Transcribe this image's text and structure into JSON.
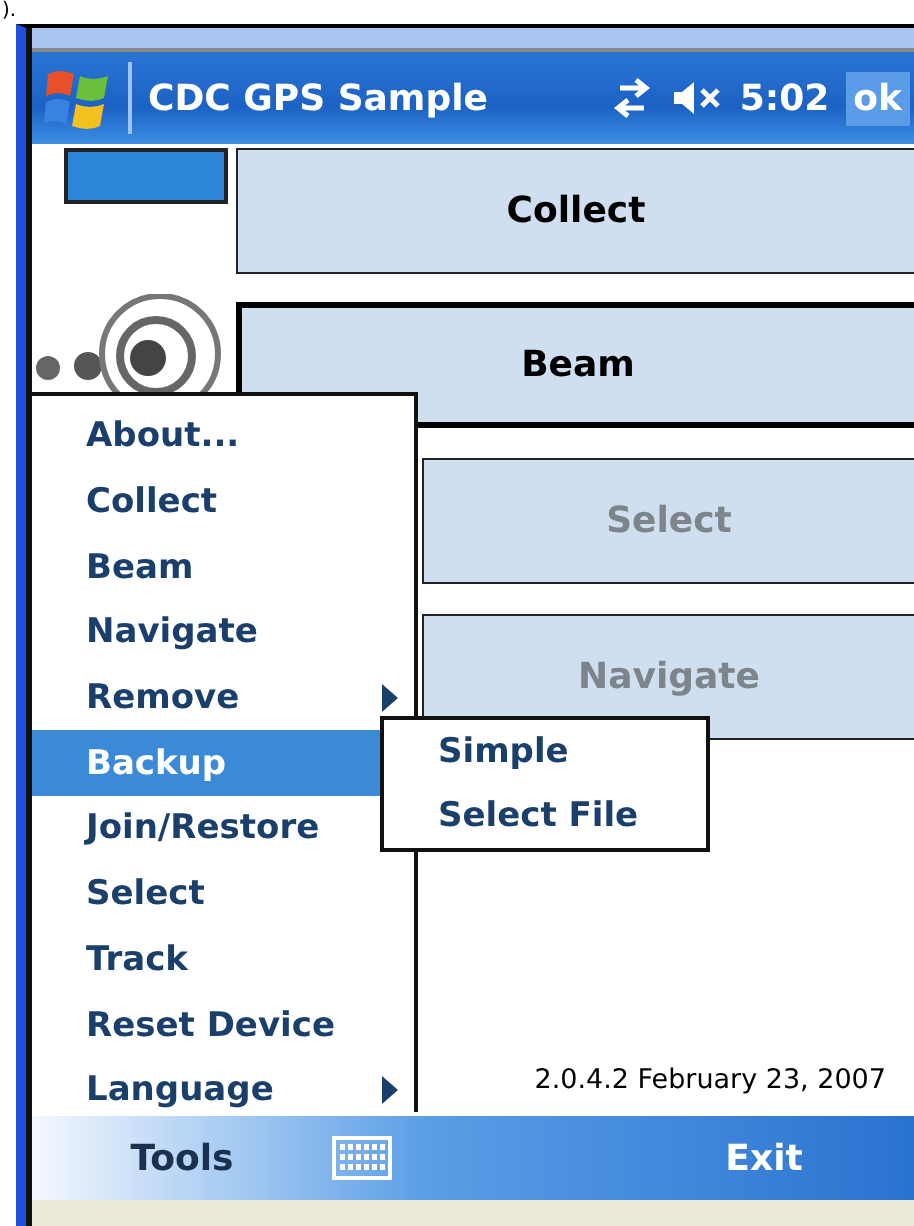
{
  "caption_fragment": ").",
  "title_bar": {
    "title": "CDC GPS Sample",
    "clock": "5:02",
    "ok_button": "ok"
  },
  "buttons": [
    {
      "label": "Collect",
      "disabled": false,
      "focused": false
    },
    {
      "label": "Beam",
      "disabled": false,
      "focused": true
    },
    {
      "label": "Select",
      "disabled": true,
      "focused": false
    },
    {
      "label": "Navigate",
      "disabled": true,
      "focused": false
    }
  ],
  "version": "2.0.4.2 February 23, 2007",
  "menu": {
    "items": [
      {
        "label": "About...",
        "selected": false
      },
      {
        "label": "Collect",
        "selected": false
      },
      {
        "label": "Beam",
        "selected": false
      },
      {
        "label": "Navigate",
        "selected": false
      },
      {
        "label": "Remove",
        "selected": false,
        "has_submenu": true
      },
      {
        "label": "Backup",
        "selected": true
      },
      {
        "label": "Join/Restore",
        "selected": false
      },
      {
        "label": "Select",
        "selected": false
      },
      {
        "label": "Track",
        "selected": false
      },
      {
        "label": "Reset Device",
        "selected": false
      },
      {
        "label": "Language",
        "selected": false,
        "has_submenu": true
      }
    ]
  },
  "submenu": {
    "items": [
      {
        "label": "Simple",
        "selected": false
      },
      {
        "label": "Select File",
        "selected": false
      }
    ]
  },
  "bottom_bar": {
    "left": "Tools",
    "right": "Exit"
  }
}
